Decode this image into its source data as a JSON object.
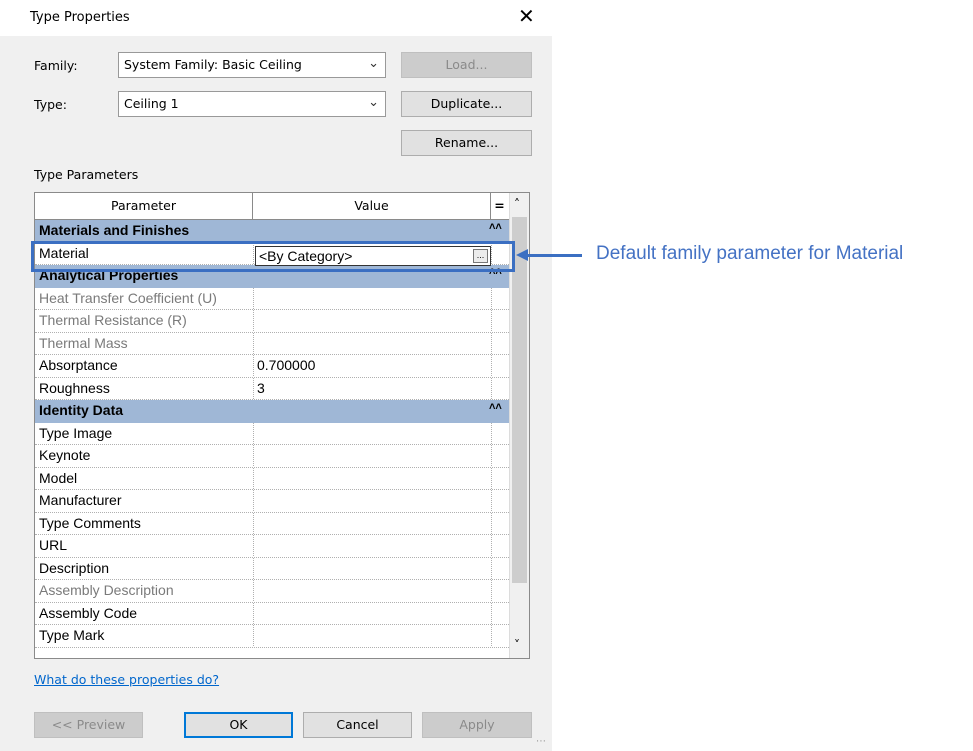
{
  "dialog": {
    "title": "Type Properties",
    "close_glyph": "✕"
  },
  "family": {
    "label": "Family:",
    "value": "System Family: Basic Ceiling",
    "load_label": "Load..."
  },
  "type": {
    "label": "Type:",
    "value": "Ceiling 1",
    "duplicate_label": "Duplicate...",
    "rename_label": "Rename..."
  },
  "params": {
    "section_label": "Type Parameters",
    "col_parameter": "Parameter",
    "col_value": "Value",
    "col_eq": "=",
    "groups": [
      {
        "name": "Materials and Finishes",
        "rows": [
          {
            "param": "Material",
            "value": "<By Category>",
            "greyed": false
          }
        ]
      },
      {
        "name": "Analytical Properties",
        "rows": [
          {
            "param": "Heat Transfer Coefficient (U)",
            "value": "",
            "greyed": true
          },
          {
            "param": "Thermal Resistance (R)",
            "value": "",
            "greyed": true
          },
          {
            "param": "Thermal Mass",
            "value": "",
            "greyed": true
          },
          {
            "param": "Absorptance",
            "value": "0.700000",
            "greyed": false
          },
          {
            "param": "Roughness",
            "value": "3",
            "greyed": false
          }
        ]
      },
      {
        "name": "Identity Data",
        "rows": [
          {
            "param": "Type Image",
            "value": "",
            "greyed": false
          },
          {
            "param": "Keynote",
            "value": "",
            "greyed": false
          },
          {
            "param": "Model",
            "value": "",
            "greyed": false
          },
          {
            "param": "Manufacturer",
            "value": "",
            "greyed": false
          },
          {
            "param": "Type Comments",
            "value": "",
            "greyed": false
          },
          {
            "param": "URL",
            "value": "",
            "greyed": false
          },
          {
            "param": "Description",
            "value": "",
            "greyed": false
          },
          {
            "param": "Assembly Description",
            "value": "",
            "greyed": true
          },
          {
            "param": "Assembly Code",
            "value": "",
            "greyed": false
          },
          {
            "param": "Type Mark",
            "value": "",
            "greyed": false
          }
        ]
      }
    ]
  },
  "annotation": {
    "text": "Default family parameter for Material",
    "color": "#4472c4"
  },
  "footer": {
    "help_link": "What do these properties do?",
    "preview_label": "<< Preview",
    "ok_label": "OK",
    "cancel_label": "Cancel",
    "apply_label": "Apply"
  },
  "icons": {
    "dropdown": "chevron-down-icon",
    "collapse": "double-chevron-up-icon",
    "browse": "ellipsis-icon"
  }
}
